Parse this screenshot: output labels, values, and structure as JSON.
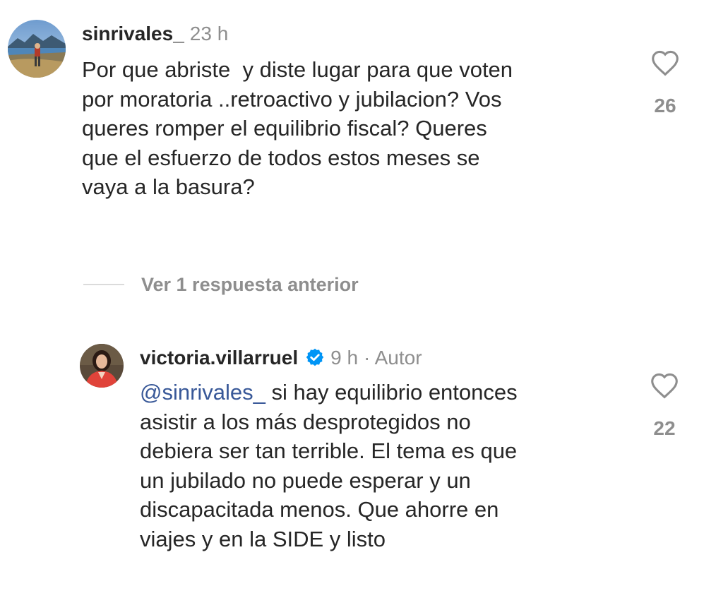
{
  "comments": [
    {
      "username": "sinrivales_",
      "time": "23 h",
      "text": "Por que abriste  y diste lugar para que voten\npor moratoria ..retroactivo y jubilacion? Vos\nqueres romper el equilibrio fiscal? Queres\nque el esfuerzo de todos estos meses se\nvaya a la basura?",
      "likes": "26",
      "avatar_icon": "profile-photo-mountain-lake"
    },
    {
      "username": "victoria.villarruel",
      "verified_icon": "verified-badge-icon",
      "time": "9 h",
      "author_tag": "· Autor",
      "mention": "@sinrivales_",
      "text": " si hay equilibrio entonces\nasistir a los más desprotegidos no\ndebiera ser tan terrible. El tema es que\nun jubilado no puede esperar y un\ndiscapacitada menos. Que ahorre en\nviajes y en la SIDE y listo",
      "likes": "22",
      "avatar_icon": "profile-photo-woman-red-jacket"
    }
  ],
  "replies_toggle": {
    "label": "Ver 1 respuesta anterior"
  },
  "colors": {
    "text": "#262626",
    "secondary": "#8e8e8e",
    "mention": "#385898",
    "verified": "#0095f6"
  }
}
